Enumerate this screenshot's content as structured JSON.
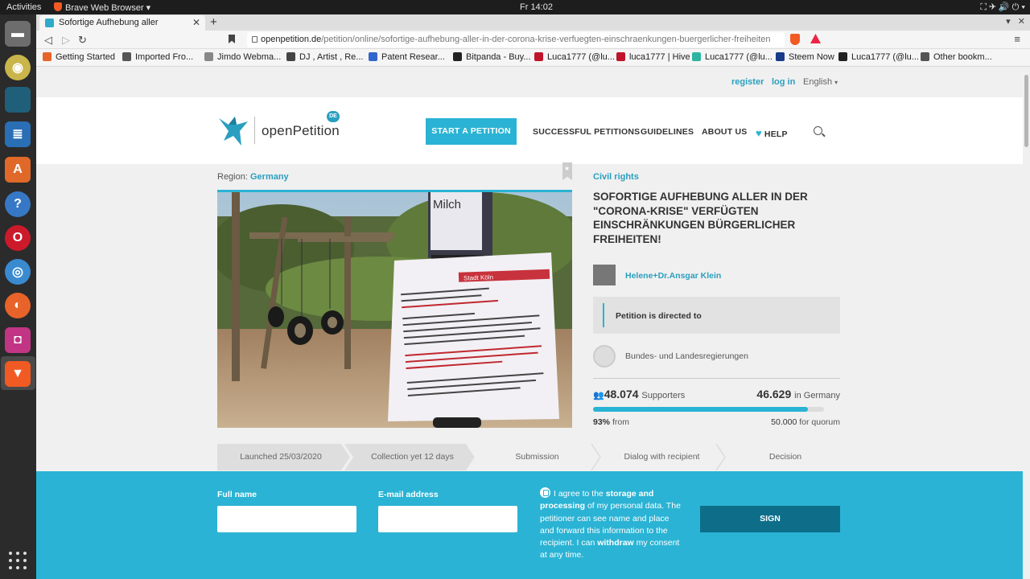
{
  "system": {
    "activities": "Activities",
    "app_menu": "Brave Web Browser ▾",
    "clock": "Fr 14:02",
    "tray": "⛶  ✈  🔊  ⏻ ▾"
  },
  "browser": {
    "tab_title": "Sofortige Aufhebung aller",
    "tab_close": "✕",
    "new_tab": "+",
    "back": "◁",
    "forward": "▷",
    "reload": "↻",
    "url_domain": "openpetition.de",
    "url_path": "/petition/online/sofortige-aufhebung-aller-in-der-corona-krise-verfuegten-einschraenkungen-buergerlicher-freiheiten",
    "menu": "≡",
    "bookmarks": [
      {
        "label": "Getting Started",
        "color": "#e8632a"
      },
      {
        "label": "Imported Fro...",
        "color": "#555555"
      },
      {
        "label": "Jimdo Webma...",
        "color": "#888888"
      },
      {
        "label": "DJ , Artist , Re...",
        "color": "#444444"
      },
      {
        "label": "Patent Resear...",
        "color": "#3366cc"
      },
      {
        "label": "Bitpanda - Buy...",
        "color": "#222222"
      },
      {
        "label": "Luca1777 (@lu...",
        "color": "#c0142a"
      },
      {
        "label": "luca1777 | Hive",
        "color": "#c0142a"
      },
      {
        "label": "Luca1777 (@lu...",
        "color": "#2bb5a0"
      },
      {
        "label": "Steem Now",
        "color": "#1a3a8a"
      },
      {
        "label": "Luca1777 (@lu...",
        "color": "#222222"
      },
      {
        "label": "Other bookm...",
        "color": "#555555"
      }
    ]
  },
  "site": {
    "register": "register",
    "login": "log in",
    "language": "English",
    "logo_text": "openPetition",
    "logo_badge": "DE",
    "start_petition": "START A PETITION",
    "nav": [
      "SUCCESSFUL PETITIONS",
      "GUIDELINES",
      "ABOUT US",
      "HELP"
    ],
    "accent": "#2ab3d4"
  },
  "petition": {
    "region_label": "Region:",
    "region_value": "Germany",
    "category": "Civil rights",
    "title": "Sofortige Aufhebung aller in der \"Corona-Krise\" verfügten Einschränkungen bürgerlicher Freiheiten!",
    "author": "Helene+Dr.Ansgar Klein",
    "directed_to": "Petition is directed to",
    "recipient": "Bundes- und Landesregierungen",
    "supporters_count": "48.074",
    "supporters_label": "Supporters",
    "germany_count": "46.629",
    "germany_label": "in Germany",
    "percent": "93%",
    "percent_label": "from",
    "quorum_value": "50.000",
    "quorum_label": "for quorum",
    "progress_fraction": 0.93,
    "photo_sign_title": "Stadt Köln",
    "photo_milk_label": "Milch"
  },
  "steps": [
    {
      "label": "Launched 25/03/2020",
      "done": true
    },
    {
      "label": "Collection yet 12 days",
      "done": true
    },
    {
      "label": "Submission",
      "done": false
    },
    {
      "label": "Dialog with recipient",
      "done": false
    },
    {
      "label": "Decision",
      "done": false
    }
  ],
  "sign_form": {
    "full_name_label": "Full name",
    "email_label": "E-mail address",
    "consent_pre": "I agree to the ",
    "consent_bold1": "storage and processing",
    "consent_mid": " of my personal data. The petitioner can see name and place and forward this information to the recipient. I can ",
    "consent_bold2": "withdraw",
    "consent_post": " my consent at any time.",
    "sign_button": "SIGN"
  }
}
